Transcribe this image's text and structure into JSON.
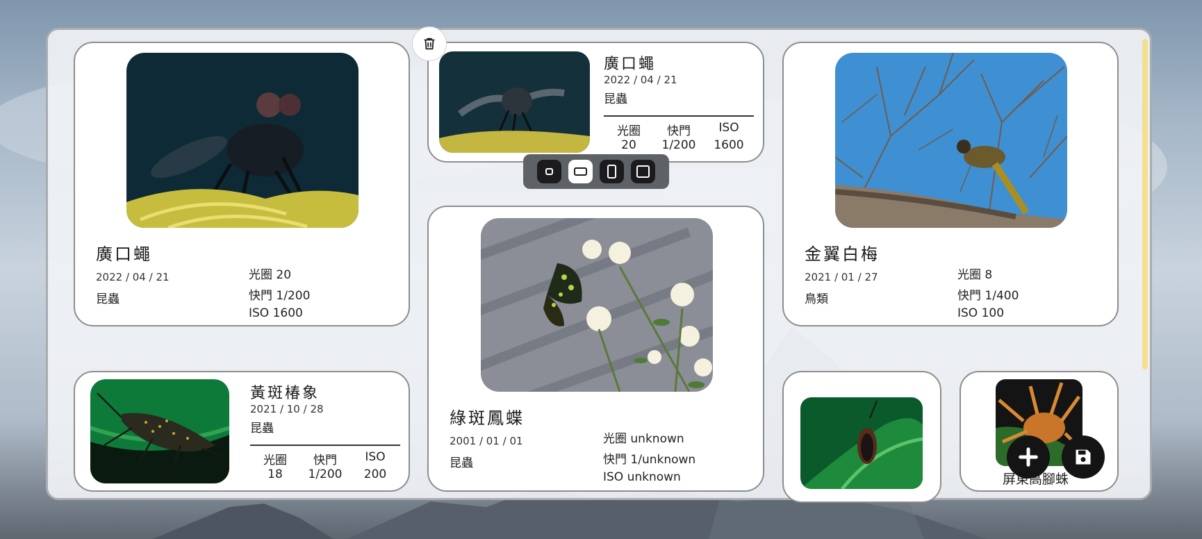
{
  "cards": {
    "fly_large": {
      "title": "廣口蠅",
      "date": "2022 / 04 / 21",
      "category": "昆蟲",
      "aperture": "光圈 20",
      "shutter": "快門 1/200",
      "iso": "ISO 1600"
    },
    "fly_small": {
      "title": "廣口蠅",
      "date": "2022 / 04 / 21",
      "category": "昆蟲",
      "col_aperture": "光圈",
      "col_shutter": "快門",
      "col_iso": "ISO",
      "val_aperture": "20",
      "val_shutter": "1/200",
      "val_iso": "1600"
    },
    "bird": {
      "title": "金翼白梅",
      "date": "2021 / 01 / 27",
      "category": "鳥類",
      "aperture": "光圈 8",
      "shutter": "快門 1/400",
      "iso": "ISO 100"
    },
    "stinkbug": {
      "title": "黃斑椿象",
      "date": "2021 / 10 / 28",
      "category": "昆蟲",
      "col_aperture": "光圈",
      "col_shutter": "快門",
      "col_iso": "ISO",
      "val_aperture": "18",
      "val_shutter": "1/200",
      "val_iso": "200"
    },
    "butterfly": {
      "title": "綠斑鳳蝶",
      "date": "2001 / 01 / 01",
      "category": "昆蟲",
      "aperture": "光圈 unknown",
      "shutter": "快門 1/unknown",
      "iso": "ISO unknown"
    },
    "spider": {
      "title": "屏東高腳蛛"
    }
  },
  "toolbar": {
    "sizes": [
      "small",
      "wide",
      "tall",
      "large"
    ],
    "active": "wide"
  },
  "icons": {
    "trash": "trash-icon",
    "add": "plus-icon",
    "save": "save-icon"
  },
  "colors": {
    "accent_scrollbar": "#f3e08c",
    "fab": "#141414",
    "toolbar": "#5e6166"
  }
}
